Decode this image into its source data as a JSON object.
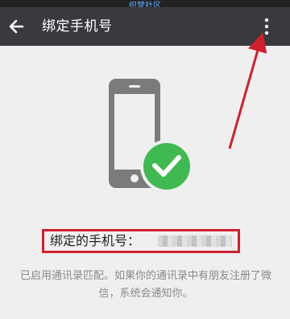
{
  "status_bar": {
    "watermark": "织梦社区"
  },
  "toolbar": {
    "title": "绑定手机号",
    "back_icon": "arrow-left-icon",
    "more_icon": "more-vertical-icon"
  },
  "content": {
    "bound_phone_label": "绑定的手机号：",
    "info_text": "已启用通讯录匹配。如果你的通讯录中有朋友注册了微信，系统会通知你。",
    "success_icon": "check-circle-icon"
  },
  "colors": {
    "toolbar_bg": "#393a3f",
    "success_green": "#3fb950",
    "annotation_red": "#d21f2e",
    "phone_gray": "#7b7b7b"
  }
}
